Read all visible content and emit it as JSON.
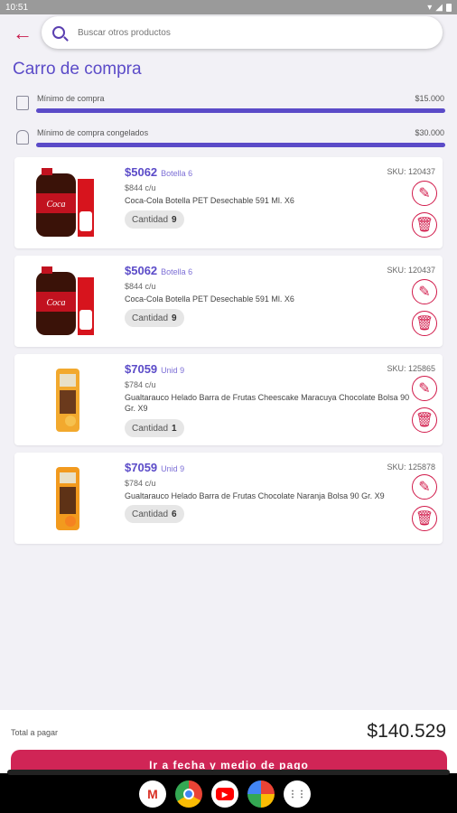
{
  "status": {
    "time": "10:51"
  },
  "search": {
    "placeholder": "Buscar otros productos"
  },
  "page": {
    "title": "Carro de compra"
  },
  "minimums": [
    {
      "label": "Mínimo de compra",
      "amount": "$15.000",
      "progress": 1.0
    },
    {
      "label": "Mínimo de compra congelados",
      "amount": "$30.000",
      "progress": 1.0
    }
  ],
  "items": [
    {
      "price": "$5062",
      "unit": "Botella 6",
      "sku": "SKU: 120437",
      "unit_price": "$844 c/u",
      "desc": "Coca-Cola Botella PET Desechable 591 Ml. X6",
      "qty_label": "Cantidad",
      "qty": "9"
    },
    {
      "price": "$5062",
      "unit": "Botella 6",
      "sku": "SKU: 120437",
      "unit_price": "$844 c/u",
      "desc": "Coca-Cola Botella PET Desechable 591 Ml. X6",
      "qty_label": "Cantidad",
      "qty": "9"
    },
    {
      "price": "$7059",
      "unit": "Unid 9",
      "sku": "SKU: 125865",
      "unit_price": "$784 c/u",
      "desc": "Gualtarauco Helado Barra de Frutas Cheescake Maracuya Chocolate Bolsa 90 Gr. X9",
      "qty_label": "Cantidad",
      "qty": "1"
    },
    {
      "price": "$7059",
      "unit": "Unid 9",
      "sku": "SKU: 125878",
      "unit_price": "$784 c/u",
      "desc": "Gualtarauco Helado Barra de Frutas Chocolate Naranja Bolsa 90 Gr. X9",
      "qty_label": "Cantidad",
      "qty": "6"
    }
  ],
  "footer": {
    "total_label": "Total a pagar",
    "total_value": "$140.529",
    "cta_label": "Ir a fecha y medio de pago"
  },
  "dock": {
    "apps": [
      "gmail-icon",
      "chrome-icon",
      "youtube-icon",
      "photos-icon",
      "app-drawer-icon"
    ]
  },
  "colors": {
    "accent": "#5b4bc8",
    "danger": "#d11a4a",
    "cta": "#d02556"
  }
}
